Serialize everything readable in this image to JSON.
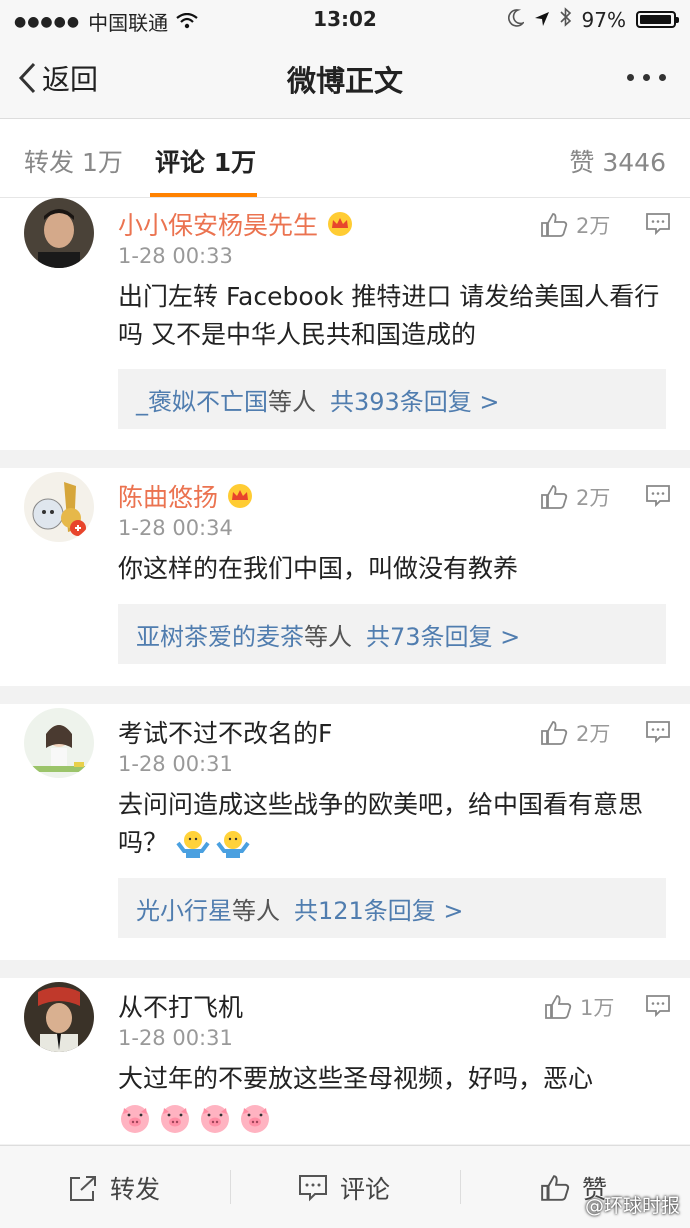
{
  "status_bar": {
    "carrier": "中国联通",
    "time": "13:02",
    "battery": "97%",
    "battery_level": 0.97
  },
  "nav": {
    "back_label": "返回",
    "title": "微博正文"
  },
  "tabs": {
    "repost": "转发 1万",
    "comment": "评论 1万",
    "like": "赞 3446"
  },
  "comments": [
    {
      "user": "小小保安杨昊先生",
      "vip": true,
      "time": "1-28 00:33",
      "likes": "2万",
      "text": "出门左转 Facebook 推特进口 请发给美国人看行吗 又不是中华人民共和国造成的",
      "reply_users": "_褒姒不亡国",
      "reply_suffix": "等人",
      "reply_count": "共393条回复 >"
    },
    {
      "user": "陈曲悠扬",
      "vip": true,
      "time": "1-28 00:34",
      "likes": "2万",
      "text": "你这样的在我们中国，叫做没有教养",
      "reply_users": "亚树茶爱的麦茶",
      "reply_suffix": "等人",
      "reply_count": "共73条回复 >"
    },
    {
      "user": "考试不过不改名的F",
      "vip": false,
      "time": "1-28 00:31",
      "likes": "2万",
      "text": "去问问造成这些战争的欧美吧，给中国看有意思吗？",
      "reply_users": "光小行星",
      "reply_suffix": "等人",
      "reply_count": "共121条回复 >"
    },
    {
      "user": "从不打飞机",
      "vip": false,
      "time": "1-28 00:31",
      "likes": "1万",
      "text": "大过年的不要放这些圣母视频，好吗，恶心"
    }
  ],
  "bottom_bar": {
    "repost": "转发",
    "comment": "评论",
    "like": "赞"
  },
  "watermark": "@环球时报",
  "colors": {
    "accent": "#ff8200",
    "vip_name": "#eb7350",
    "link": "#507daf"
  }
}
